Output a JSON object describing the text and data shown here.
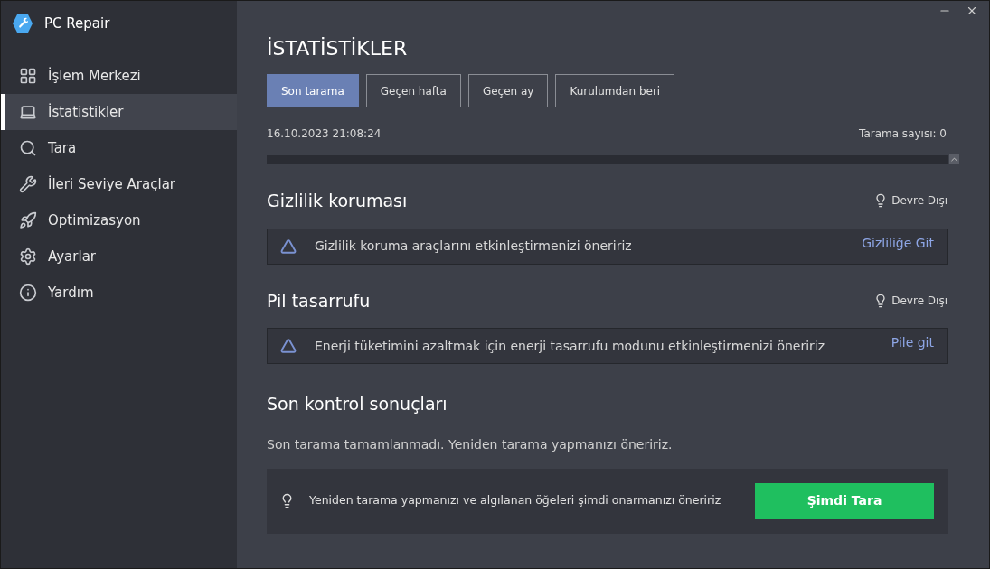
{
  "app": {
    "title": "PC Repair"
  },
  "sidebar": {
    "items": [
      {
        "label": "İşlem Merkezi",
        "kind": "grid",
        "selected": false
      },
      {
        "label": "İstatistikler",
        "kind": "laptop",
        "selected": true
      },
      {
        "label": "Tara",
        "kind": "search",
        "selected": false
      },
      {
        "label": "İleri Seviye Araçlar",
        "kind": "wrench",
        "selected": false
      },
      {
        "label": "Optimizasyon",
        "kind": "rocket",
        "selected": false
      },
      {
        "label": "Ayarlar",
        "kind": "settings",
        "selected": false
      },
      {
        "label": "Yardım",
        "kind": "info",
        "selected": false
      }
    ]
  },
  "page": {
    "title": "İSTATİSTİKLER",
    "tabs": [
      {
        "label": "Son tarama",
        "selected": true
      },
      {
        "label": "Geçen hafta",
        "selected": false
      },
      {
        "label": "Geçen ay",
        "selected": false
      },
      {
        "label": "Kurulumdan beri",
        "selected": false
      }
    ],
    "timestamp": "16.10.2023 21:08:24",
    "scan_count": "Tarama sayısı: 0"
  },
  "sections": [
    {
      "title": "Gizlilik koruması",
      "status": "Devre Dışı",
      "message": "Gizlilik koruma araçlarını etkinleştirmenizi öneririz",
      "link": "Gizliliğe Git"
    },
    {
      "title": "Pil tasarrufu",
      "status": "Devre Dışı",
      "message": "Enerji tüketimini azaltmak için enerji tasarrufu modunu etkinleştirmenizi öneririz",
      "link": "Pile git"
    }
  ],
  "results": {
    "title": "Son kontrol sonuçları",
    "summary": "Son tarama tamamlanmadı. Yeniden tarama yapmanızı öneririz.",
    "tip": "Yeniden tarama yapmanızı ve algılanan öğeleri şimdi onarmanızı öneririz",
    "button": "Şimdi Tara"
  }
}
